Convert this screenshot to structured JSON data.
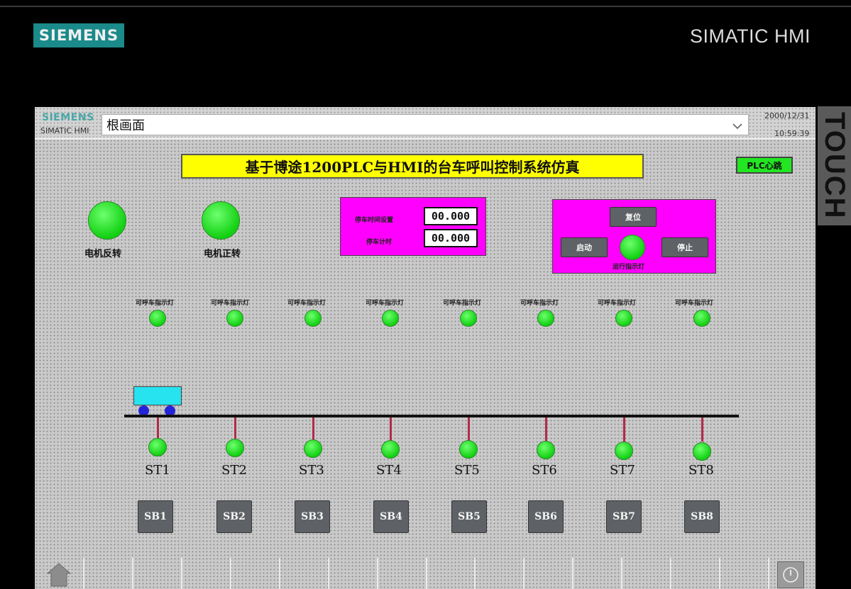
{
  "bezel": {
    "brand_logo": "SIEMENS",
    "brand_right": "SIMATIC HMI",
    "side_label": "TOUCH"
  },
  "header": {
    "logo": "SIEMENS",
    "sub": "SIMATIC HMI",
    "screen_name": "根画面",
    "date": "2000/12/31",
    "time": "10:59:39"
  },
  "title": "基于博途1200PLC与HMI的台车呼叫控制系统仿真",
  "plc_heartbeat": "PLC心跳",
  "motors": {
    "reverse_label": "电机反转",
    "forward_label": "电机正转"
  },
  "timer_panel": {
    "set_label": "停车时间设置",
    "set_value": "00.000",
    "count_label": "停车计时",
    "count_value": "00.000"
  },
  "control_panel": {
    "reset": "复位",
    "start": "启动",
    "stop": "停止",
    "run_label": "运行指示灯"
  },
  "call_lamp_label": "可呼车指示灯",
  "stations": [
    "ST1",
    "ST2",
    "ST3",
    "ST4",
    "ST5",
    "ST6",
    "ST7",
    "ST8"
  ],
  "buttons": [
    "SB1",
    "SB2",
    "SB3",
    "SB4",
    "SB5",
    "SB6",
    "SB7",
    "SB8"
  ],
  "colors": {
    "lamp_on": "#12d012",
    "title_bg": "#ffff00",
    "panel_bg": "#ff00ff",
    "cart": "#27e3ef",
    "plc": "#22e622"
  }
}
